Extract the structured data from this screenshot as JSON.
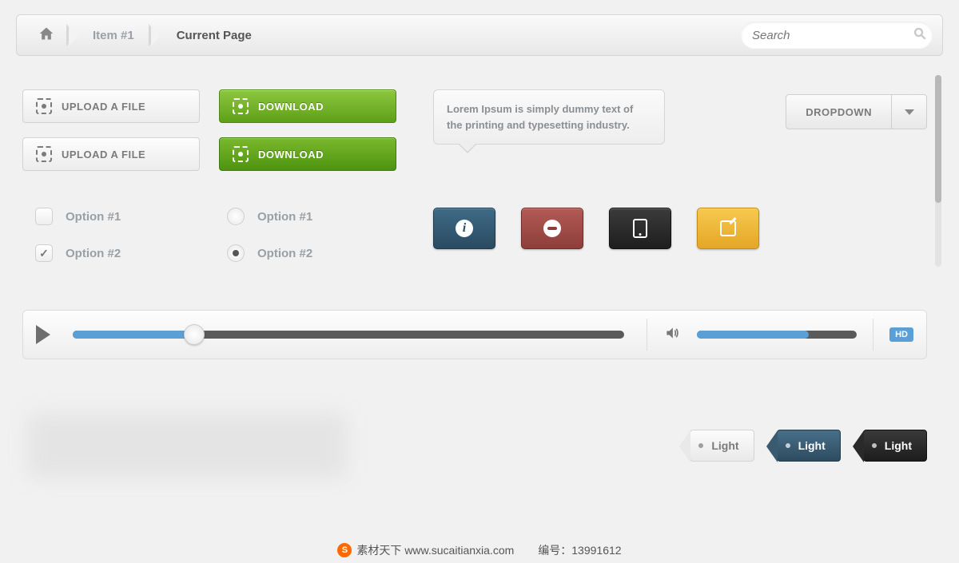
{
  "breadcrumb": {
    "item1": "Item #1",
    "current": "Current Page"
  },
  "search": {
    "placeholder": "Search"
  },
  "buttons": {
    "upload": "UPLOAD A FILE",
    "download": "DOWNLOAD"
  },
  "tooltip": {
    "text": "Lorem Ipsum is simply dummy text of the printing and typesetting industry."
  },
  "dropdown": {
    "label": "DROPDOWN"
  },
  "options": {
    "checkbox": [
      {
        "label": "Option #1",
        "checked": false
      },
      {
        "label": "Option #2",
        "checked": true
      }
    ],
    "radio": [
      {
        "label": "Option #1",
        "selected": false
      },
      {
        "label": "Option #2",
        "selected": true
      }
    ]
  },
  "iconButtons": {
    "info": "info",
    "block": "block",
    "device": "tablet",
    "edit": "edit"
  },
  "player": {
    "progress_pct": 22,
    "volume_pct": 70,
    "hd": "HD"
  },
  "tags": {
    "light1": "Light",
    "light2": "Light",
    "light3": "Light"
  },
  "footer": {
    "site": "素材天下 www.sucaitianxia.com",
    "id_label": "编号：",
    "id": "13991612"
  }
}
